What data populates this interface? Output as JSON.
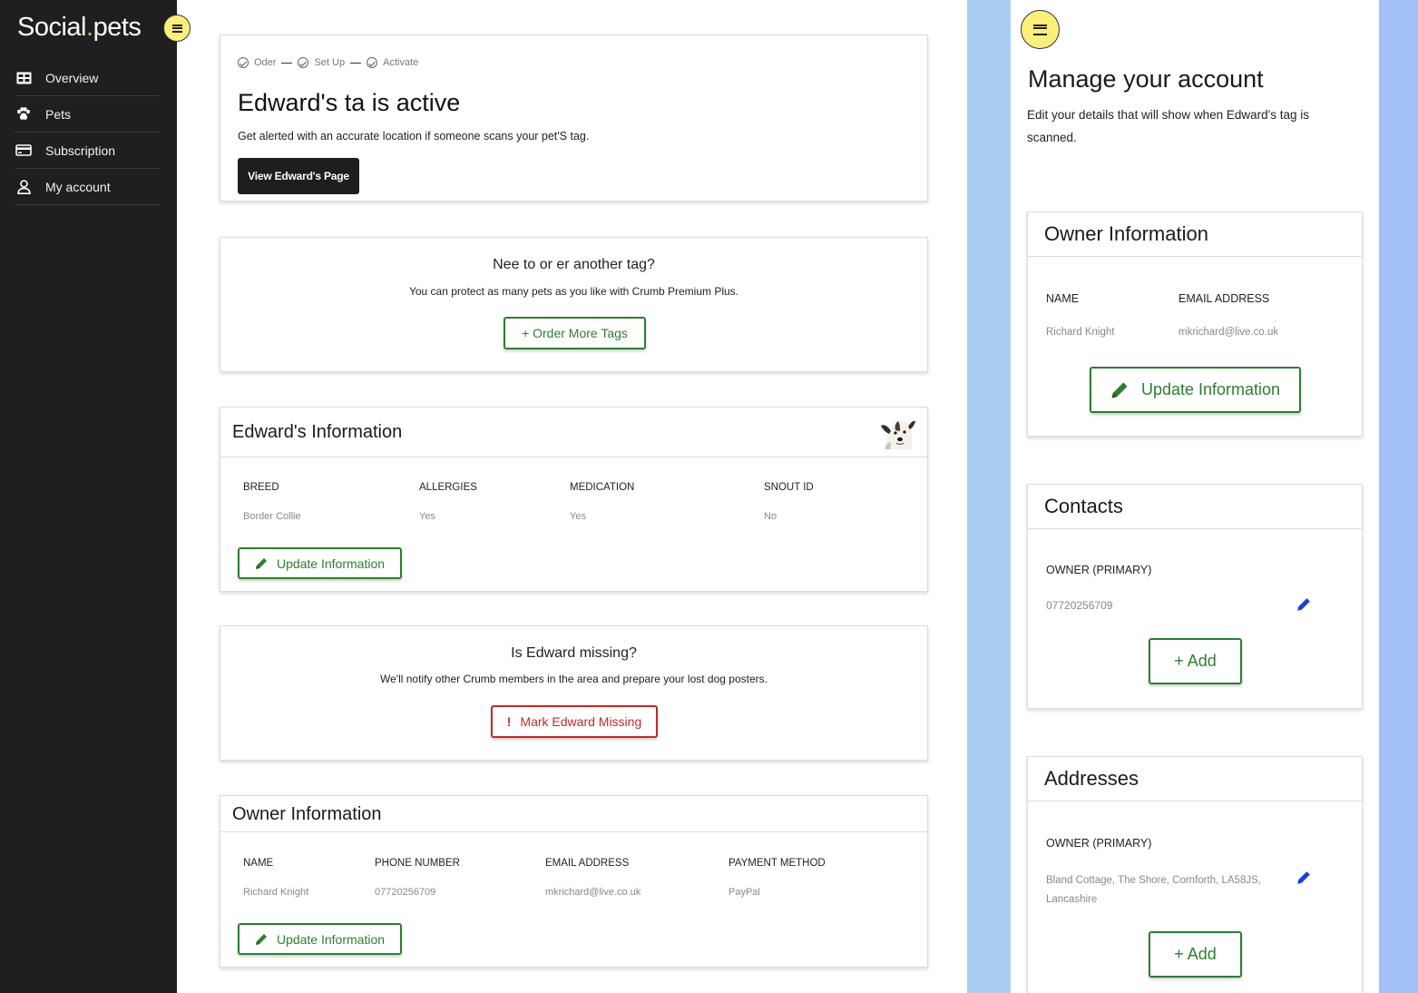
{
  "app": {
    "logo_left": "Social",
    "logo_dot": ".",
    "logo_right": "pets"
  },
  "sidebar": {
    "items": [
      {
        "label": "Overview",
        "icon": "overview-icon"
      },
      {
        "label": "Pets",
        "icon": "paw-icon"
      },
      {
        "label": "Subscription",
        "icon": "card-icon"
      },
      {
        "label": "My account",
        "icon": "user-icon"
      }
    ]
  },
  "status_card": {
    "steps": [
      "Oder",
      "Set Up",
      "Activate"
    ],
    "title": "Edward's ta is active",
    "subtitle": "Get alerted with an accurate location if someone scans your pet'S tag.",
    "button": "View Edward's Page"
  },
  "order_card": {
    "title": "Nee to or er another tag?",
    "subtitle": "You can protect as many pets as you like with Crumb Premium Plus.",
    "button": "+ Order More Tags"
  },
  "pet_info": {
    "title": "Edward's Information",
    "labels": [
      "BREED",
      "ALLERGIES",
      "MEDICATION",
      "SNOUT ID"
    ],
    "values": [
      "Border Collie",
      "Yes",
      "Yes",
      "No"
    ],
    "button": "Update Information"
  },
  "missing_card": {
    "title": "Is Edward missing?",
    "subtitle": "We'll notify other Crumb members in the area and prepare your lost dog posters.",
    "button_mark": "!",
    "button": "Mark Edward Missing"
  },
  "owner_info": {
    "title": "Owner Information",
    "labels": [
      "NAME",
      "PHONE NUMBER",
      "EMAIL ADDRESS",
      "PAYMENT METHOD"
    ],
    "values": [
      "Richard Knight",
      "07720256709",
      "mkrichard@live.co.uk",
      "PayPal"
    ],
    "button": "Update Information"
  },
  "account": {
    "title": "Manage your account",
    "subtitle": "Edit your details that will show when Edward's tag is scanned.",
    "owner": {
      "title": "Owner Information",
      "labels": [
        "NAME",
        "EMAIL ADDRESS"
      ],
      "values": [
        "Richard Knight",
        "mkrichard@live.co.uk"
      ],
      "button": "Update Information"
    },
    "contacts": {
      "title": "Contacts",
      "label": "OWNER (PRIMARY)",
      "value": "07720256709",
      "button": "+ Add"
    },
    "addresses": {
      "title": "Addresses",
      "label": "OWNER (PRIMARY)",
      "value": "Bland Cottage, The Shore, Cornforth, LA58JS, Lancashire",
      "button": "+ Add"
    }
  },
  "colors": {
    "sidebar": "#1f1f1f",
    "toggle": "#fbef7c",
    "green": "#2e7d32",
    "red": "#c62828",
    "edit_blue": "#1e3fd6",
    "strip": "#a9cdf2"
  }
}
